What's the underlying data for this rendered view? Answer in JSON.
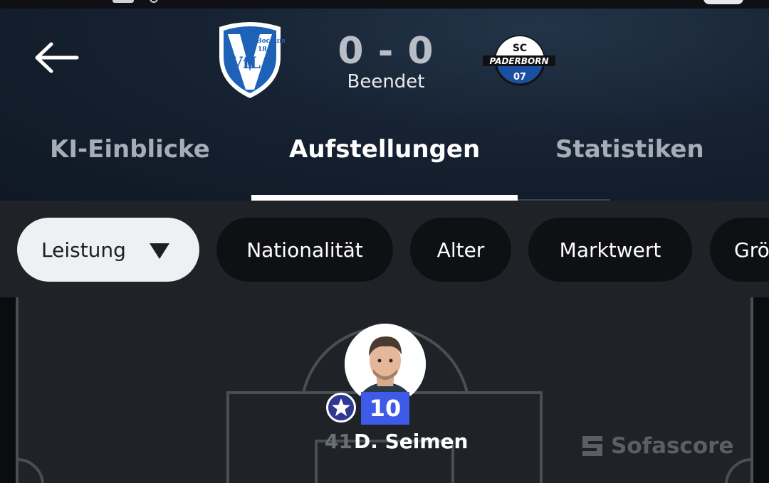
{
  "match": {
    "home_team_logo_text": [
      "VfL",
      "Bochum",
      "1848"
    ],
    "away_team_logo_text": [
      "SC",
      "PADERBORN",
      "07"
    ],
    "score": "0 - 0",
    "status": "Beendet"
  },
  "tabs": [
    {
      "label": "KI-Einblicke",
      "active": false
    },
    {
      "label": "Aufstellungen",
      "active": true
    },
    {
      "label": "Statistiken",
      "active": false
    }
  ],
  "filters": [
    {
      "label": "Leistung",
      "active": true,
      "dropdown": true
    },
    {
      "label": "Nationalität",
      "active": false
    },
    {
      "label": "Alter",
      "active": false
    },
    {
      "label": "Marktwert",
      "active": false
    },
    {
      "label": "Grö",
      "active": false
    }
  ],
  "player": {
    "number": "41",
    "name": "D. Seimen",
    "rating": "10",
    "badge_icon": "star-icon",
    "rating_color": "#3d5be6"
  },
  "watermark": {
    "text": "Sofascore",
    "icon": "sofascore-logo-icon"
  },
  "colors": {
    "accent": "#3d5be6",
    "header_bg": "#162232",
    "chip_active_bg": "#eef0f2"
  }
}
